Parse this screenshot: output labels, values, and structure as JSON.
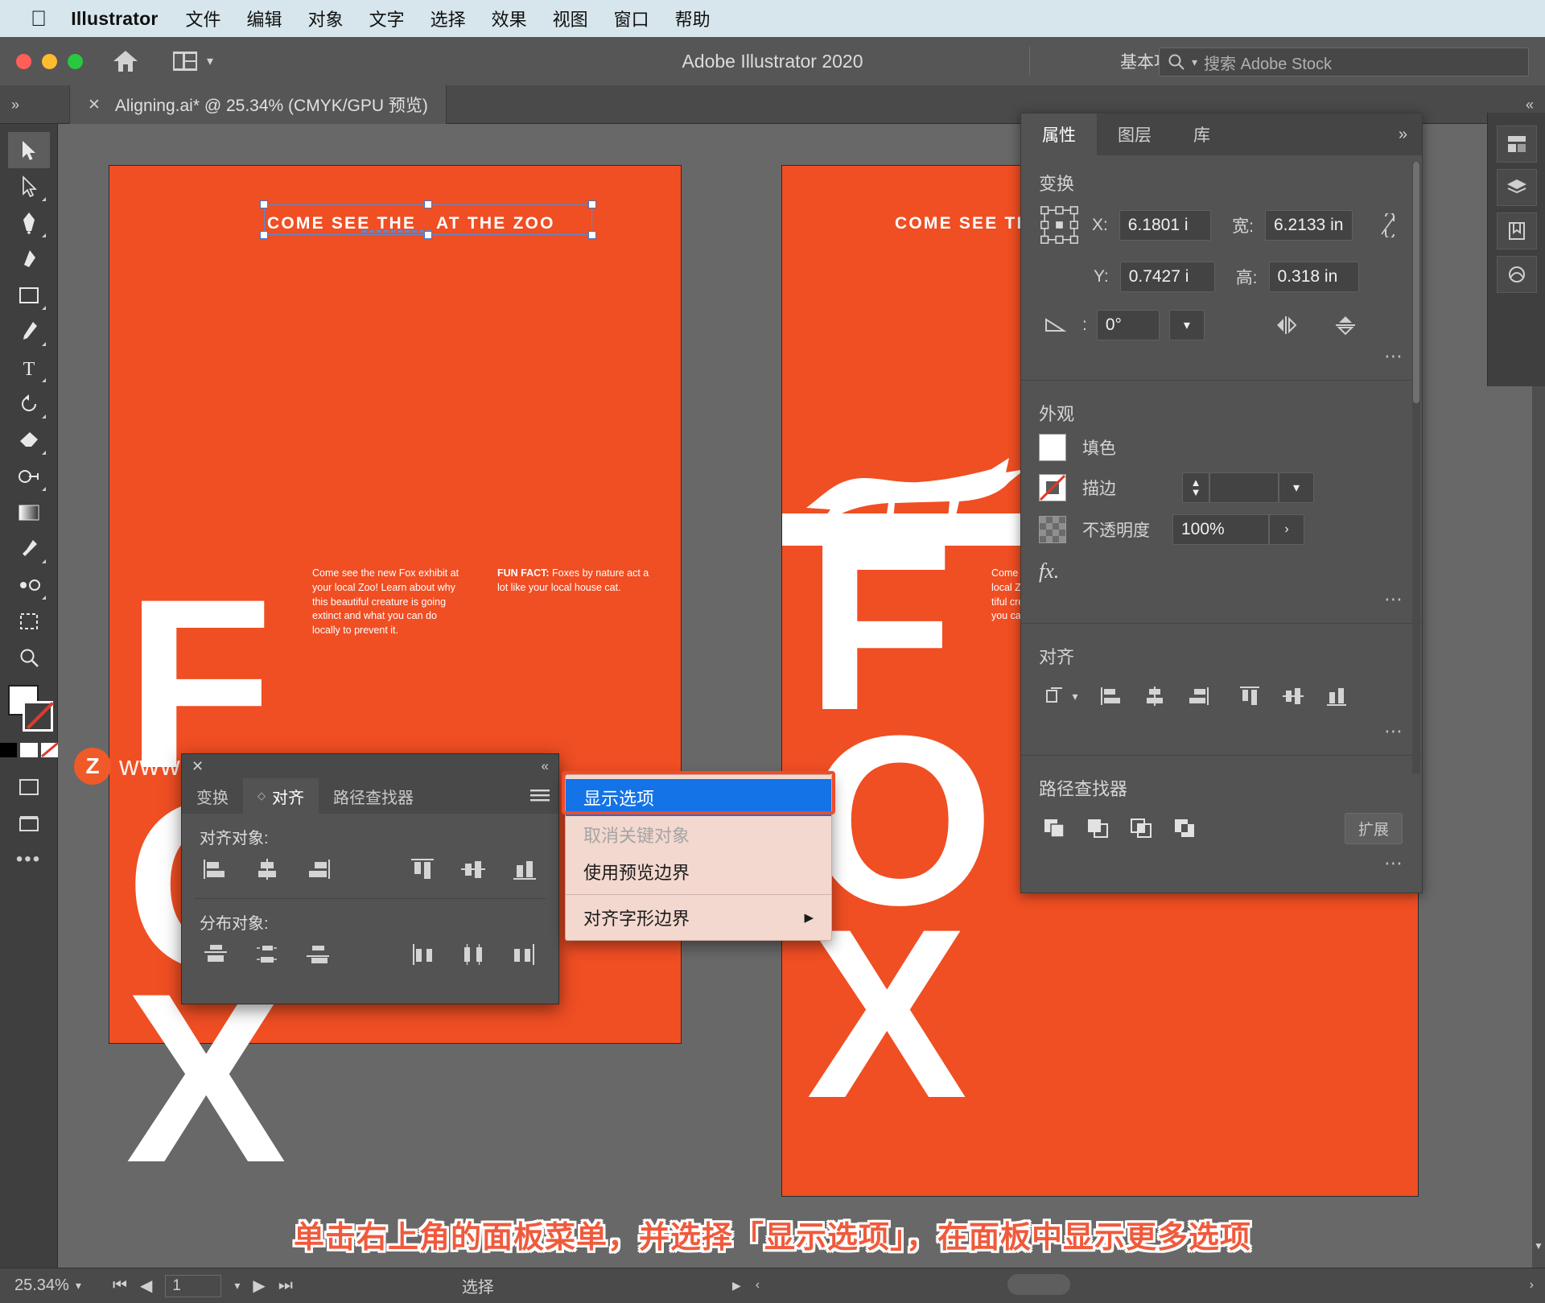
{
  "macmenu": {
    "apple_icon": "apple-icon",
    "app": "Illustrator",
    "items": [
      "文件",
      "编辑",
      "对象",
      "文字",
      "选择",
      "效果",
      "视图",
      "窗口",
      "帮助"
    ]
  },
  "titlebar": {
    "title": "Adobe Illustrator 2020",
    "workspace": "基本功能",
    "workspace_chevron": "chevron-down-icon",
    "home_icon": "home-icon",
    "arrange_icon": "arrange-documents-icon",
    "search_placeholder": "搜索 Adobe Stock",
    "search_icon": "search-icon"
  },
  "tabbar": {
    "close_icon": "close-icon",
    "doc_tab": "Aligning.ai* @ 25.34% (CMYK/GPU 预览)"
  },
  "toolbar": {
    "tools": [
      {
        "name": "selection-tool",
        "label": "选择工具"
      },
      {
        "name": "direct-selection-tool",
        "label": "直接选择工具"
      },
      {
        "name": "pen-tool",
        "label": "钢笔工具"
      },
      {
        "name": "curvature-tool",
        "label": "曲率工具"
      },
      {
        "name": "rectangle-tool",
        "label": "矩形工具"
      },
      {
        "name": "paintbrush-tool",
        "label": "画笔工具"
      },
      {
        "name": "type-tool",
        "label": "文字工具"
      },
      {
        "name": "rotate-tool",
        "label": "旋转工具"
      },
      {
        "name": "eraser-tool",
        "label": "橡皮擦工具"
      },
      {
        "name": "shape-builder-tool",
        "label": "形状生成器工具"
      },
      {
        "name": "gradient-tool",
        "label": "渐变工具"
      },
      {
        "name": "eyedropper-tool",
        "label": "吸管工具"
      },
      {
        "name": "blend-tool",
        "label": "混合工具"
      },
      {
        "name": "artboard-tool",
        "label": "画板工具"
      },
      {
        "name": "zoom-tool",
        "label": "缩放工具"
      },
      {
        "name": "more-tools",
        "label": "编辑工具栏"
      }
    ],
    "fill_label": "填色",
    "stroke_label": "描边",
    "more_dots": "•••"
  },
  "artwork": {
    "headline1": "COME SEE THE",
    "headline1b": "AT THE ZOO",
    "headline2": "COME SEE TH",
    "fox_word": "FOX",
    "body_left": "Come see the new Fox exhibit at your local Zoo! Learn about why this beautiful creature is going extinct and what you can do locally to prevent it.",
    "body_right_bold": "FUN FACT:",
    "body_right": " Foxes by nature act a lot like your local house cat.",
    "body_right2_1": "Come s",
    "body_right2_2": "local Z",
    "body_right2_3": "tiful cre",
    "body_right2_4": "you ca",
    "orange": "#f04e23"
  },
  "properties": {
    "tabs": [
      {
        "label": "属性",
        "active": true
      },
      {
        "label": "图层",
        "active": false
      },
      {
        "label": "库",
        "active": false
      }
    ],
    "collapse_icon": "chevrons-right-icon",
    "transform": {
      "title": "变换",
      "reference_point_icon": "reference-point-icon",
      "x_label": "X:",
      "x_value": "6.1801 i",
      "y_label": "Y:",
      "y_value": "0.7427 i",
      "w_label": "宽:",
      "w_value": "6.2133 in",
      "h_label": "高:",
      "h_value": "0.318 in",
      "link_icon": "unlink-proportions-icon",
      "angle_icon": "angle-icon",
      "angle_value": "0°",
      "angle_chevron": "chevron-down-icon",
      "flip_h_icon": "flip-horizontal-icon",
      "flip_v_icon": "flip-vertical-icon",
      "more_icon": "more-options-icon"
    },
    "appearance": {
      "title": "外观",
      "fill_label": "填色",
      "fill_swatch_icon": "fill-swatch-icon",
      "stroke_label": "描边",
      "stroke_swatch_icon": "stroke-none-swatch-icon",
      "stroke_weight_value": "",
      "stroke_stepper_icon": "stepper-icon",
      "stroke_chevron": "chevron-down-icon",
      "opacity_label": "不透明度",
      "opacity_swatch_icon": "opacity-checker-icon",
      "opacity_value": "100%",
      "opacity_arrow": "chevron-right-icon",
      "fx_label": "fx.",
      "more_icon": "more-options-icon"
    },
    "align": {
      "title": "对齐",
      "target_icon": "align-to-selection-icon",
      "target_chevron": "chevron-down-icon",
      "buttons": [
        "align-left-icon",
        "align-horizontal-center-icon",
        "align-right-icon",
        "align-top-icon",
        "align-vertical-center-icon",
        "align-bottom-icon"
      ],
      "more_icon": "more-options-icon"
    },
    "pathfinder": {
      "title": "路径查找器",
      "buttons": [
        "unite-icon",
        "minus-front-icon",
        "intersect-icon",
        "exclude-icon"
      ],
      "expand_label": "扩展",
      "more_icon": "more-options-icon"
    }
  },
  "right_rail": {
    "buttons": [
      "properties-rail-icon",
      "layers-rail-icon",
      "libraries-rail-icon",
      "brushes-rail-icon"
    ]
  },
  "align_panel": {
    "close_icon": "close-icon",
    "collapse_icon": "chevrons-left-icon",
    "tabs": [
      {
        "label": "变换",
        "active": false
      },
      {
        "label": "对齐",
        "active": true
      },
      {
        "label": "路径查找器",
        "active": false
      }
    ],
    "menu_icon": "panel-menu-icon",
    "align_objects_label": "对齐对象:",
    "align_buttons": [
      "align-left-icon",
      "align-horizontal-center-icon",
      "align-right-icon",
      "align-top-icon",
      "align-vertical-center-icon",
      "align-bottom-icon"
    ],
    "distribute_objects_label": "分布对象:",
    "distribute_buttons": [
      "distribute-vertical-top-icon",
      "distribute-vertical-center-icon",
      "distribute-vertical-bottom-icon",
      "distribute-horizontal-left-icon",
      "distribute-horizontal-center-icon",
      "distribute-horizontal-right-icon"
    ]
  },
  "context_menu": {
    "items": [
      {
        "label": "显示选项",
        "state": "highlighted",
        "submenu": false
      },
      {
        "label": "取消关键对象",
        "state": "disabled",
        "submenu": false
      },
      {
        "label": "使用预览边界",
        "state": "normal",
        "submenu": false
      },
      {
        "label": "对齐字形边界",
        "state": "normal",
        "submenu": true
      }
    ],
    "submenu_arrow_icon": "triangle-right-icon",
    "highlight_color": "#1473e6",
    "annotation_ring_color": "#ef4c2b"
  },
  "caption": {
    "text": "单击右上角的面板菜单，并选择「显示选项」，在面板中显示更多选项",
    "color": "#f05a3c"
  },
  "statusbar": {
    "zoom": "25.34%",
    "zoom_chevron": "chevron-down-icon",
    "first_icon": "first-artboard-icon",
    "prev_icon": "prev-artboard-icon",
    "page": "1",
    "page_chevron": "chevron-down-icon",
    "next_icon": "next-artboard-icon",
    "last_icon": "last-artboard-icon",
    "mode": "选择",
    "mode_arrow": "triangle-right-icon",
    "scroll_left_icon": "chevron-left-icon",
    "scroll_right_icon": "chevron-right-icon"
  },
  "watermark": {
    "badge": "Z",
    "text": "www.MacZ.com"
  }
}
